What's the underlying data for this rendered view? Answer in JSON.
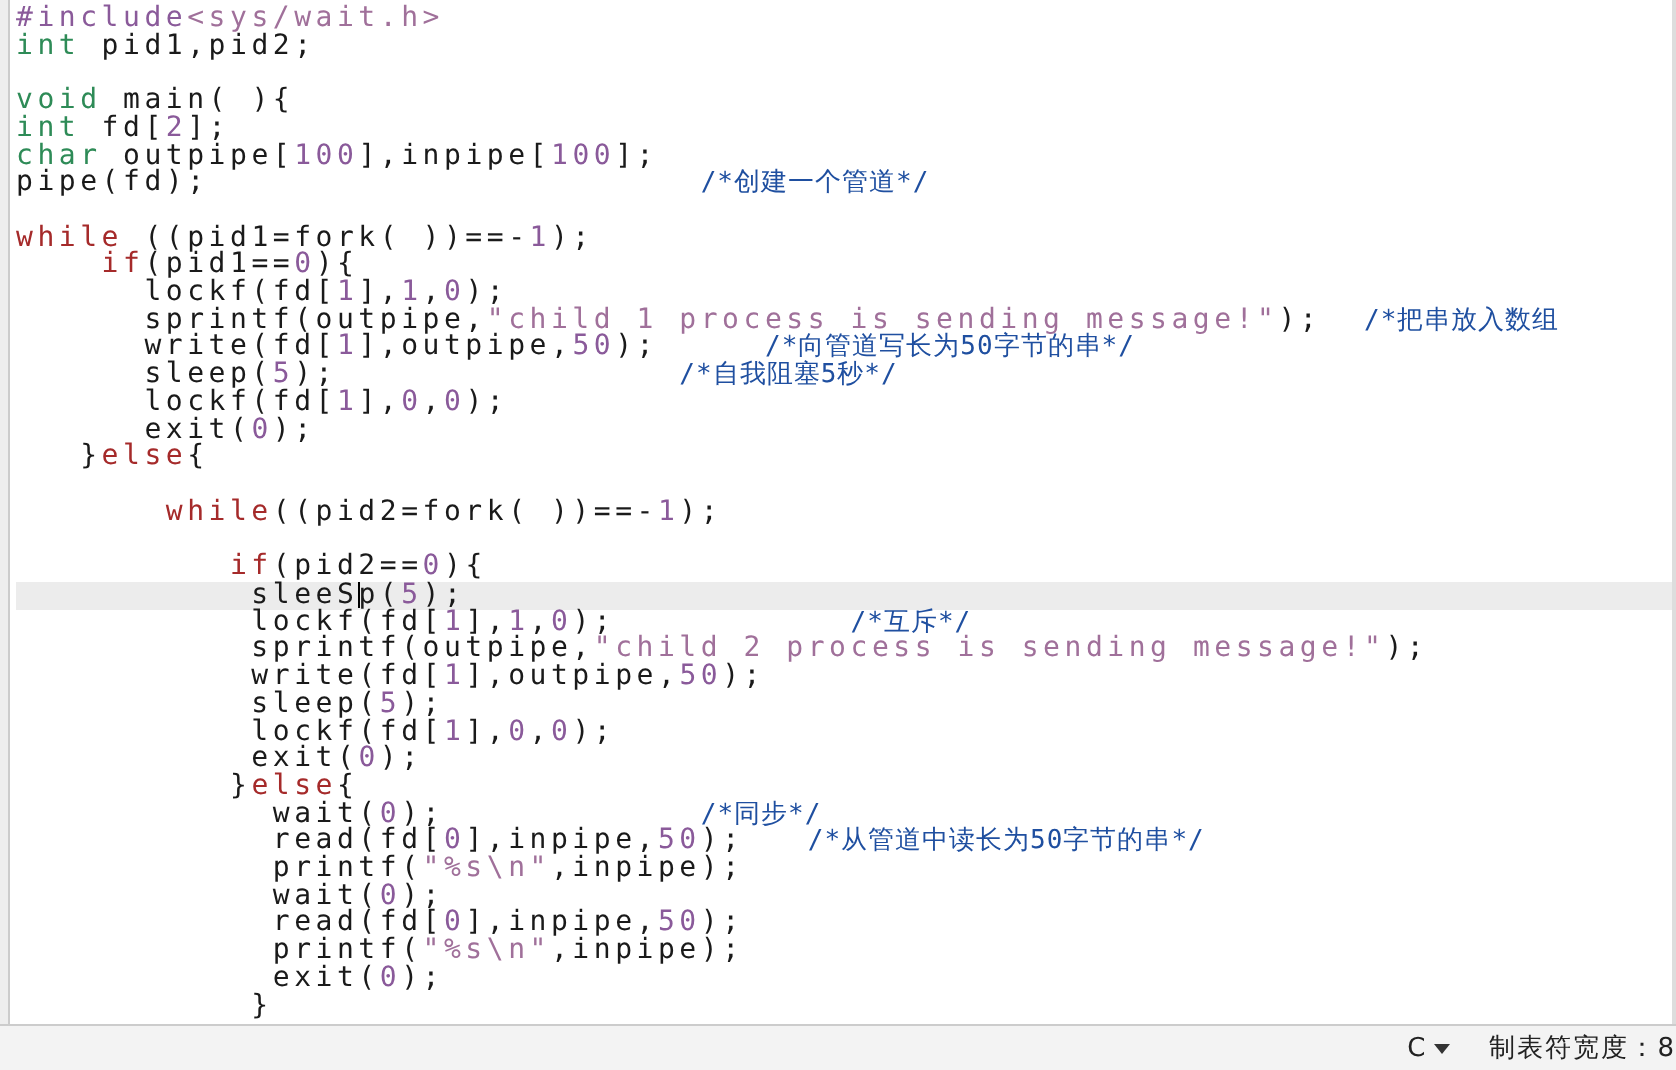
{
  "editor": {
    "lines": [
      {
        "tokens": [
          {
            "kind": "preproc",
            "text": "#include"
          },
          {
            "kind": "string",
            "text": "<sys/wait.h>"
          }
        ]
      },
      {
        "tokens": [
          {
            "kind": "type",
            "text": "int"
          },
          {
            "kind": "text",
            "text": " pid1,pid2;"
          }
        ],
        "blank_after": true
      },
      {
        "tokens": [
          {
            "kind": "type",
            "text": "void"
          },
          {
            "kind": "text",
            "text": " main( ){"
          }
        ]
      },
      {
        "tokens": [
          {
            "kind": "type",
            "text": "int"
          },
          {
            "kind": "text",
            "text": " fd["
          },
          {
            "kind": "number",
            "text": "2"
          },
          {
            "kind": "text",
            "text": "];"
          }
        ]
      },
      {
        "tokens": [
          {
            "kind": "type",
            "text": "char"
          },
          {
            "kind": "text",
            "text": " outpipe["
          },
          {
            "kind": "number",
            "text": "100"
          },
          {
            "kind": "text",
            "text": "],inpipe["
          },
          {
            "kind": "number",
            "text": "100"
          },
          {
            "kind": "text",
            "text": "];"
          }
        ]
      },
      {
        "tokens": [
          {
            "kind": "text",
            "text": "pipe(fd);                       "
          }
        ],
        "comment": "/*创建一个管道*/",
        "blank_after": true
      },
      {
        "tokens": [
          {
            "kind": "keyword",
            "text": "while"
          },
          {
            "kind": "text",
            "text": " ((pid1=fork( ))==-"
          },
          {
            "kind": "number",
            "text": "1"
          },
          {
            "kind": "text",
            "text": ");"
          }
        ]
      },
      {
        "tokens": [
          {
            "kind": "keyword",
            "text": "    if"
          },
          {
            "kind": "text",
            "text": "(pid1=="
          },
          {
            "kind": "number",
            "text": "0"
          },
          {
            "kind": "text",
            "text": "){"
          }
        ]
      },
      {
        "tokens": [
          {
            "kind": "text",
            "text": "      lockf(fd["
          },
          {
            "kind": "number",
            "text": "1"
          },
          {
            "kind": "text",
            "text": "],"
          },
          {
            "kind": "number",
            "text": "1"
          },
          {
            "kind": "text",
            "text": ","
          },
          {
            "kind": "number",
            "text": "0"
          },
          {
            "kind": "text",
            "text": ");"
          }
        ]
      },
      {
        "tokens": [
          {
            "kind": "text",
            "text": "      sprintf(outpipe,"
          },
          {
            "kind": "string",
            "text": "\"child 1 process is sending message!\""
          },
          {
            "kind": "text",
            "text": ");  "
          }
        ],
        "comment": "/*把串放入数组"
      },
      {
        "tokens": [
          {
            "kind": "text",
            "text": "      write(fd["
          },
          {
            "kind": "number",
            "text": "1"
          },
          {
            "kind": "text",
            "text": "],outpipe,"
          },
          {
            "kind": "number",
            "text": "50"
          },
          {
            "kind": "text",
            "text": ");     "
          }
        ],
        "comment": "/*向管道写长为50字节的串*/"
      },
      {
        "tokens": [
          {
            "kind": "text",
            "text": "      sleep("
          },
          {
            "kind": "number",
            "text": "5"
          },
          {
            "kind": "text",
            "text": ");                "
          }
        ],
        "comment": "/*自我阻塞5秒*/"
      },
      {
        "tokens": [
          {
            "kind": "text",
            "text": "      lockf(fd["
          },
          {
            "kind": "number",
            "text": "1"
          },
          {
            "kind": "text",
            "text": "],"
          },
          {
            "kind": "number",
            "text": "0"
          },
          {
            "kind": "text",
            "text": ","
          },
          {
            "kind": "number",
            "text": "0"
          },
          {
            "kind": "text",
            "text": ");"
          }
        ]
      },
      {
        "tokens": [
          {
            "kind": "text",
            "text": "      exit("
          },
          {
            "kind": "number",
            "text": "0"
          },
          {
            "kind": "text",
            "text": ");"
          }
        ]
      },
      {
        "tokens": [
          {
            "kind": "text",
            "text": "   }"
          },
          {
            "kind": "keyword",
            "text": "else"
          },
          {
            "kind": "text",
            "text": "{"
          }
        ],
        "blank_after": true
      },
      {
        "tokens": [
          {
            "kind": "keyword",
            "text": "       while"
          },
          {
            "kind": "text",
            "text": "((pid2=fork( ))==-"
          },
          {
            "kind": "number",
            "text": "1"
          },
          {
            "kind": "text",
            "text": ");"
          }
        ],
        "blank_after": true
      },
      {
        "tokens": [
          {
            "kind": "keyword",
            "text": "          if"
          },
          {
            "kind": "text",
            "text": "(pid2=="
          },
          {
            "kind": "number",
            "text": "0"
          },
          {
            "kind": "text",
            "text": "){"
          }
        ]
      },
      {
        "current": true,
        "tokens": [
          {
            "kind": "text",
            "text": "           sleeS"
          },
          {
            "kind": "cursor"
          },
          {
            "kind": "text",
            "text": "p("
          },
          {
            "kind": "number",
            "text": "5"
          },
          {
            "kind": "text",
            "text": ");"
          }
        ]
      },
      {
        "tokens": [
          {
            "kind": "text",
            "text": "           lockf(fd["
          },
          {
            "kind": "number",
            "text": "1"
          },
          {
            "kind": "text",
            "text": "],"
          },
          {
            "kind": "number",
            "text": "1"
          },
          {
            "kind": "text",
            "text": ","
          },
          {
            "kind": "number",
            "text": "0"
          },
          {
            "kind": "text",
            "text": ");           "
          }
        ],
        "comment": "/*互斥*/"
      },
      {
        "tokens": [
          {
            "kind": "text",
            "text": "           sprintf(outpipe,"
          },
          {
            "kind": "string",
            "text": "\"child 2 process is sending message!\""
          },
          {
            "kind": "text",
            "text": ");"
          }
        ]
      },
      {
        "tokens": [
          {
            "kind": "text",
            "text": "           write(fd["
          },
          {
            "kind": "number",
            "text": "1"
          },
          {
            "kind": "text",
            "text": "],outpipe,"
          },
          {
            "kind": "number",
            "text": "50"
          },
          {
            "kind": "text",
            "text": ");"
          }
        ]
      },
      {
        "tokens": [
          {
            "kind": "text",
            "text": "           sleep("
          },
          {
            "kind": "number",
            "text": "5"
          },
          {
            "kind": "text",
            "text": ");"
          }
        ]
      },
      {
        "tokens": [
          {
            "kind": "text",
            "text": "           lockf(fd["
          },
          {
            "kind": "number",
            "text": "1"
          },
          {
            "kind": "text",
            "text": "],"
          },
          {
            "kind": "number",
            "text": "0"
          },
          {
            "kind": "text",
            "text": ","
          },
          {
            "kind": "number",
            "text": "0"
          },
          {
            "kind": "text",
            "text": ");"
          }
        ]
      },
      {
        "tokens": [
          {
            "kind": "text",
            "text": "           exit("
          },
          {
            "kind": "number",
            "text": "0"
          },
          {
            "kind": "text",
            "text": ");"
          }
        ]
      },
      {
        "tokens": [
          {
            "kind": "text",
            "text": "          }"
          },
          {
            "kind": "keyword",
            "text": "else"
          },
          {
            "kind": "text",
            "text": "{"
          }
        ]
      },
      {
        "tokens": [
          {
            "kind": "text",
            "text": "            wait("
          },
          {
            "kind": "number",
            "text": "0"
          },
          {
            "kind": "text",
            "text": ");            "
          }
        ],
        "comment": "/*同步*/"
      },
      {
        "tokens": [
          {
            "kind": "text",
            "text": "            read(fd["
          },
          {
            "kind": "number",
            "text": "0"
          },
          {
            "kind": "text",
            "text": "],inpipe,"
          },
          {
            "kind": "number",
            "text": "50"
          },
          {
            "kind": "text",
            "text": ");   "
          }
        ],
        "comment": "/*从管道中读长为50字节的串*/"
      },
      {
        "tokens": [
          {
            "kind": "text",
            "text": "            printf("
          },
          {
            "kind": "string",
            "text": "\"%s\\n\""
          },
          {
            "kind": "text",
            "text": ",inpipe);"
          }
        ]
      },
      {
        "tokens": [
          {
            "kind": "text",
            "text": "            wait("
          },
          {
            "kind": "number",
            "text": "0"
          },
          {
            "kind": "text",
            "text": ");"
          }
        ]
      },
      {
        "tokens": [
          {
            "kind": "text",
            "text": "            read(fd["
          },
          {
            "kind": "number",
            "text": "0"
          },
          {
            "kind": "text",
            "text": "],inpipe,"
          },
          {
            "kind": "number",
            "text": "50"
          },
          {
            "kind": "text",
            "text": ");"
          }
        ]
      },
      {
        "tokens": [
          {
            "kind": "text",
            "text": "            printf("
          },
          {
            "kind": "string",
            "text": "\"%s\\n\""
          },
          {
            "kind": "text",
            "text": ",inpipe);"
          }
        ]
      },
      {
        "tokens": [
          {
            "kind": "text",
            "text": "            exit("
          },
          {
            "kind": "number",
            "text": "0"
          },
          {
            "kind": "text",
            "text": ");"
          }
        ]
      },
      {
        "tokens": [
          {
            "kind": "text",
            "text": "           }"
          }
        ]
      }
    ]
  },
  "status_bar": {
    "language": "C",
    "tab_width": "制表符宽度：8"
  }
}
